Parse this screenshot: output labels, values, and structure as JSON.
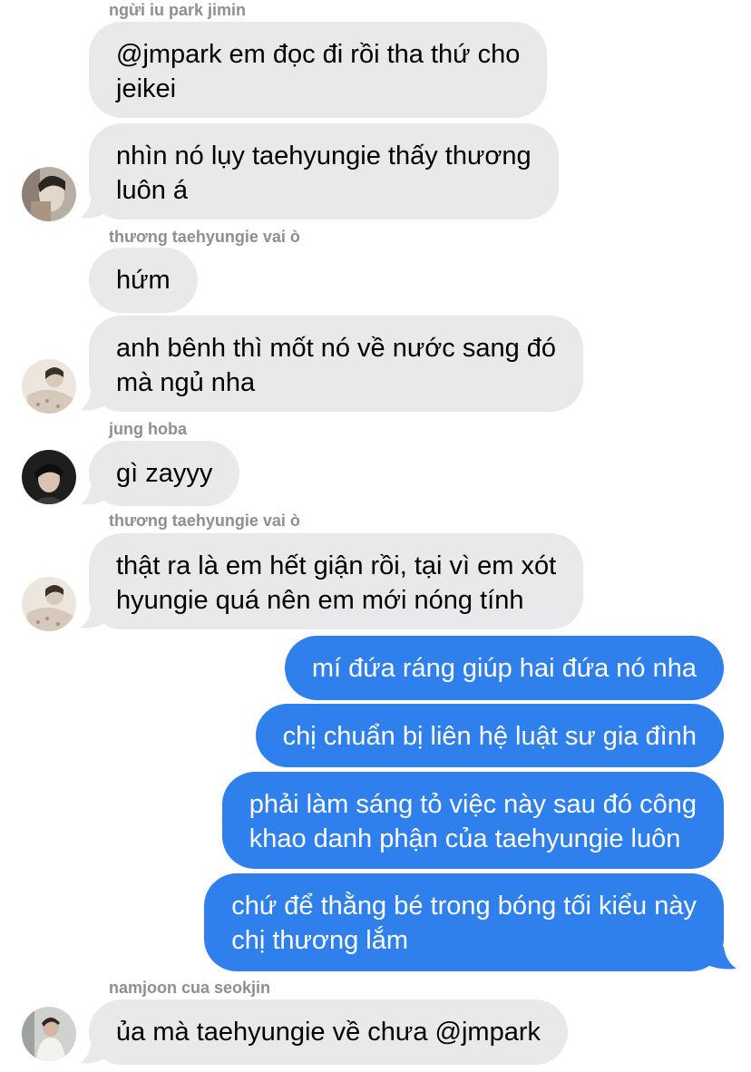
{
  "colors": {
    "incoming_bubble": "#e9e9eb",
    "outgoing_bubble": "#2f80ed",
    "sender_label": "#8e8e93"
  },
  "messages": [
    {
      "sender": "ngừi iu park jimin",
      "direction": "in",
      "lines": [
        "@jmpark em đọc đi rồi tha thứ cho",
        "jeikei"
      ]
    },
    {
      "sender": "",
      "direction": "in",
      "lines": [
        "nhìn nó lụy taehyungie thấy thương",
        "luôn á"
      ],
      "avatar": "avatar-jimin"
    },
    {
      "sender": "thương taehyungie vai ò",
      "direction": "in",
      "lines": [
        "hứm"
      ]
    },
    {
      "sender": "",
      "direction": "in",
      "lines": [
        "anh bênh thì mốt nó về nước sang đó",
        "mà ngủ nha"
      ],
      "avatar": "avatar-taehyung-fan"
    },
    {
      "sender": "jung hoba",
      "direction": "in",
      "lines": [
        "gì zayyy"
      ],
      "avatar": "avatar-hoba"
    },
    {
      "sender": "thương taehyungie vai ò",
      "direction": "in",
      "lines": [
        "thật ra là em hết giận rồi, tại vì em xót",
        "hyungie quá nên em mới nóng tính"
      ],
      "avatar": "avatar-taehyung-fan"
    },
    {
      "sender": "",
      "direction": "out",
      "lines": [
        "mí đứa ráng giúp hai đứa nó nha"
      ]
    },
    {
      "sender": "",
      "direction": "out",
      "lines": [
        "chị chuẩn bị liên hệ luật sư gia đình"
      ]
    },
    {
      "sender": "",
      "direction": "out",
      "lines": [
        "phải làm sáng tỏ việc này sau đó công",
        "khao danh phận của taehyungie luôn"
      ]
    },
    {
      "sender": "",
      "direction": "out",
      "lines": [
        "chứ để thằng bé trong bóng tối kiểu này",
        "chị thương lắm"
      ]
    },
    {
      "sender": "namjoon cua seokjin",
      "direction": "in",
      "lines": [
        "ủa mà taehyungie về chưa @jmpark"
      ],
      "avatar": "avatar-namjoon"
    }
  ]
}
